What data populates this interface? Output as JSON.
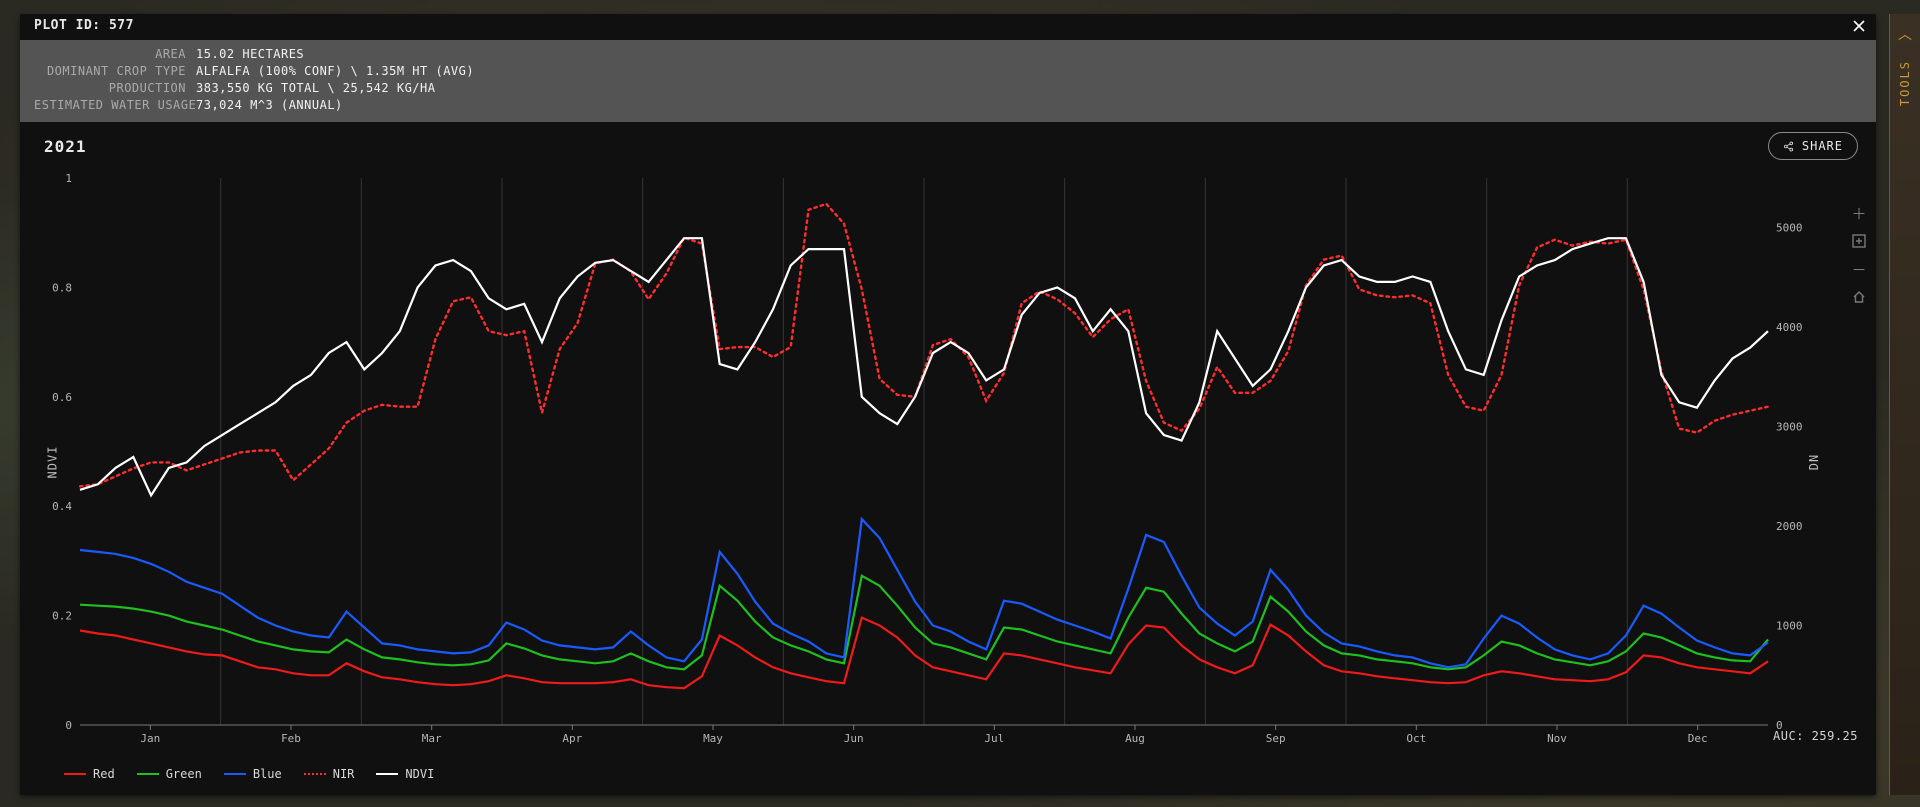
{
  "title": "PLOT ID: 577",
  "info": {
    "area_label": "Area",
    "area_value": "15.02 Hectares",
    "crop_label": "Dominant Crop Type",
    "crop_value": "Alfalfa (100% Conf) \\ 1.35m HT (Avg)",
    "prod_label": "Production",
    "prod_value": "383,550 kg Total \\ 25,542 kg/ha",
    "water_label": "Estimated Water Usage",
    "water_value": "73,024 m^3 (Annual)"
  },
  "year": "2021",
  "share_label": "SHARE",
  "left_axis_label": "NDVI",
  "right_axis_label": "DN",
  "auc_text": "AUC: 259.25",
  "legend": {
    "red": "Red",
    "green": "Green",
    "blue": "Blue",
    "nir": "NIR",
    "ndvi": "NDVI"
  },
  "tools_rail_label": "TOOLS",
  "chart_data": {
    "type": "line",
    "x_categories": [
      "Jan",
      "Feb",
      "Mar",
      "Apr",
      "May",
      "Jun",
      "Jul",
      "Aug",
      "Sep",
      "Oct",
      "Nov",
      "Dec"
    ],
    "left_axis": {
      "label": "NDVI",
      "min": 0,
      "max": 1,
      "ticks": [
        0,
        0.2,
        0.4,
        0.6,
        0.8,
        1
      ]
    },
    "right_axis": {
      "label": "DN",
      "min": 0,
      "max": 5500,
      "ticks": [
        0,
        1000,
        2000,
        3000,
        4000,
        5000
      ]
    },
    "series_right_axis": [
      {
        "name": "Red",
        "color": "#ef1a1a",
        "values": [
          950,
          920,
          900,
          860,
          820,
          780,
          740,
          710,
          700,
          640,
          580,
          560,
          520,
          500,
          500,
          620,
          540,
          480,
          460,
          430,
          410,
          400,
          410,
          440,
          500,
          470,
          430,
          420,
          420,
          420,
          430,
          460,
          400,
          380,
          370,
          490,
          900,
          800,
          680,
          580,
          520,
          480,
          440,
          420,
          1080,
          1000,
          880,
          700,
          580,
          540,
          500,
          460,
          720,
          700,
          660,
          620,
          580,
          550,
          520,
          810,
          1000,
          980,
          800,
          660,
          580,
          520,
          600,
          1010,
          900,
          740,
          600,
          540,
          520,
          490,
          470,
          450,
          430,
          420,
          430,
          500,
          540,
          520,
          490,
          460,
          450,
          440,
          460,
          530,
          700,
          680,
          620,
          580,
          560,
          540,
          520,
          640
        ]
      },
      {
        "name": "Green",
        "color": "#1fbf1f",
        "values": [
          1210,
          1200,
          1190,
          1170,
          1140,
          1100,
          1040,
          1000,
          960,
          900,
          840,
          800,
          760,
          740,
          730,
          860,
          760,
          680,
          660,
          630,
          610,
          600,
          610,
          650,
          820,
          770,
          700,
          660,
          640,
          620,
          640,
          720,
          640,
          580,
          560,
          700,
          1400,
          1250,
          1040,
          880,
          800,
          740,
          660,
          620,
          1500,
          1400,
          1200,
          980,
          820,
          780,
          720,
          660,
          980,
          960,
          900,
          840,
          800,
          760,
          720,
          1080,
          1380,
          1340,
          1120,
          920,
          820,
          740,
          840,
          1290,
          1140,
          940,
          800,
          720,
          700,
          660,
          640,
          620,
          580,
          560,
          580,
          700,
          840,
          800,
          720,
          660,
          630,
          600,
          640,
          740,
          920,
          880,
          800,
          720,
          680,
          650,
          640,
          860
        ]
      },
      {
        "name": "Blue",
        "color": "#1a5bff",
        "values": [
          1760,
          1740,
          1720,
          1680,
          1620,
          1540,
          1440,
          1380,
          1320,
          1200,
          1080,
          1000,
          940,
          900,
          880,
          1140,
          980,
          820,
          800,
          760,
          740,
          720,
          730,
          800,
          1030,
          960,
          850,
          800,
          780,
          760,
          780,
          940,
          800,
          680,
          640,
          860,
          1740,
          1520,
          1240,
          1020,
          920,
          840,
          720,
          680,
          2070,
          1880,
          1560,
          1240,
          1000,
          940,
          840,
          760,
          1250,
          1220,
          1140,
          1060,
          1000,
          940,
          870,
          1370,
          1910,
          1840,
          1500,
          1180,
          1020,
          900,
          1040,
          1560,
          1360,
          1100,
          930,
          820,
          790,
          740,
          700,
          680,
          620,
          580,
          610,
          870,
          1100,
          1020,
          880,
          760,
          700,
          660,
          720,
          900,
          1200,
          1120,
          980,
          850,
          780,
          720,
          700,
          830
        ]
      },
      {
        "name": "NIR",
        "color": "#ff2d2d",
        "style": "dash",
        "values": [
          2400,
          2420,
          2500,
          2580,
          2640,
          2640,
          2560,
          2620,
          2680,
          2740,
          2760,
          2760,
          2460,
          2620,
          2780,
          3040,
          3160,
          3220,
          3200,
          3200,
          3880,
          4260,
          4300,
          3960,
          3920,
          3960,
          3140,
          3780,
          4040,
          4640,
          4680,
          4560,
          4280,
          4540,
          4900,
          4840,
          3780,
          3800,
          3800,
          3700,
          3800,
          5180,
          5240,
          5040,
          4380,
          3480,
          3320,
          3300,
          3820,
          3880,
          3700,
          3260,
          3540,
          4240,
          4360,
          4280,
          4140,
          3900,
          4080,
          4180,
          3460,
          3040,
          2960,
          3180,
          3600,
          3340,
          3340,
          3460,
          3760,
          4420,
          4680,
          4720,
          4380,
          4320,
          4300,
          4320,
          4240,
          3520,
          3200,
          3160,
          3520,
          4420,
          4800,
          4880,
          4820,
          4860,
          4840,
          4880,
          4380,
          3560,
          2980,
          2940,
          3060,
          3120,
          3160,
          3200
        ]
      }
    ],
    "series_left_axis": [
      {
        "name": "NDVI",
        "color": "#ffffff",
        "values": [
          0.43,
          0.44,
          0.47,
          0.49,
          0.42,
          0.47,
          0.48,
          0.51,
          0.53,
          0.55,
          0.57,
          0.59,
          0.62,
          0.64,
          0.68,
          0.7,
          0.65,
          0.68,
          0.72,
          0.8,
          0.84,
          0.85,
          0.83,
          0.78,
          0.76,
          0.77,
          0.7,
          0.78,
          0.82,
          0.845,
          0.85,
          0.83,
          0.81,
          0.85,
          0.89,
          0.89,
          0.66,
          0.65,
          0.7,
          0.76,
          0.84,
          0.87,
          0.87,
          0.87,
          0.6,
          0.57,
          0.55,
          0.6,
          0.68,
          0.7,
          0.68,
          0.63,
          0.65,
          0.75,
          0.79,
          0.8,
          0.78,
          0.72,
          0.76,
          0.72,
          0.57,
          0.53,
          0.52,
          0.59,
          0.72,
          0.67,
          0.62,
          0.65,
          0.72,
          0.8,
          0.84,
          0.85,
          0.82,
          0.81,
          0.81,
          0.82,
          0.81,
          0.72,
          0.65,
          0.64,
          0.74,
          0.82,
          0.84,
          0.85,
          0.87,
          0.88,
          0.89,
          0.89,
          0.81,
          0.64,
          0.59,
          0.58,
          0.63,
          0.67,
          0.69,
          0.72
        ]
      }
    ]
  }
}
